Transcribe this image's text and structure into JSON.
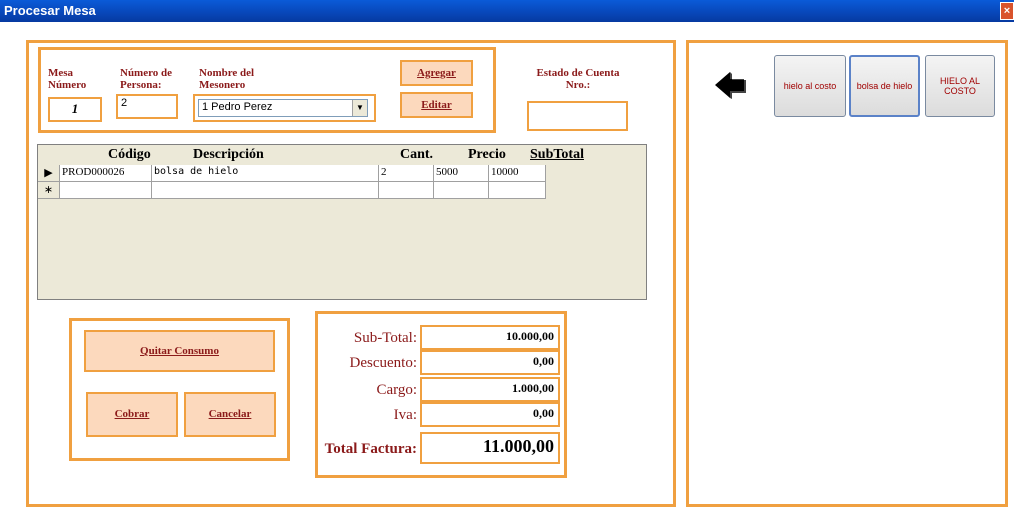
{
  "window": {
    "title": "Procesar Mesa",
    "close_glyph": "×"
  },
  "header_form": {
    "mesa_label": "Mesa Número",
    "mesa_value": "1",
    "personas_label": "Número de Persona:",
    "personas_value": "2",
    "mesonero_label": "Nombre del Mesonero",
    "mesonero_value": "1 Pedro Perez",
    "agregar_label": "Agregar",
    "editar_label": "Editar",
    "estado_label": "Estado de Cuenta Nro.:",
    "estado_value": ""
  },
  "grid": {
    "columns": [
      "Código",
      "Descripción",
      "Cant.",
      "Precio",
      "SubTotal"
    ],
    "rows": [
      {
        "marker": "▶",
        "codigo": "PROD000026",
        "descripcion": "bolsa de hielo",
        "cant": "2",
        "precio": "5000",
        "subtotal": "10000"
      }
    ],
    "new_row_marker": "∗"
  },
  "actions": {
    "quitar_label": "Quitar Consumo",
    "cobrar_label": "Cobrar",
    "cancelar_label": "Cancelar"
  },
  "totals": {
    "subtotal_label": "Sub-Total:",
    "subtotal_value": "10.000,00",
    "descuento_label": "Descuento:",
    "descuento_value": "0,00",
    "cargo_label": "Cargo:",
    "cargo_value": "1.000,00",
    "iva_label": "Iva:",
    "iva_value": "0,00",
    "total_label": "Total Factura:",
    "total_value": "11.000,00"
  },
  "products": {
    "back_icon": "back-arrow-icon",
    "items": [
      "hielo al costo",
      "bolsa de hielo",
      "HIELO AL COSTO"
    ]
  },
  "colors": {
    "accent": "#f0a040",
    "label": "#8b1a1a",
    "button_fill": "#fcd9bd",
    "titlebar": "#0846b8"
  }
}
